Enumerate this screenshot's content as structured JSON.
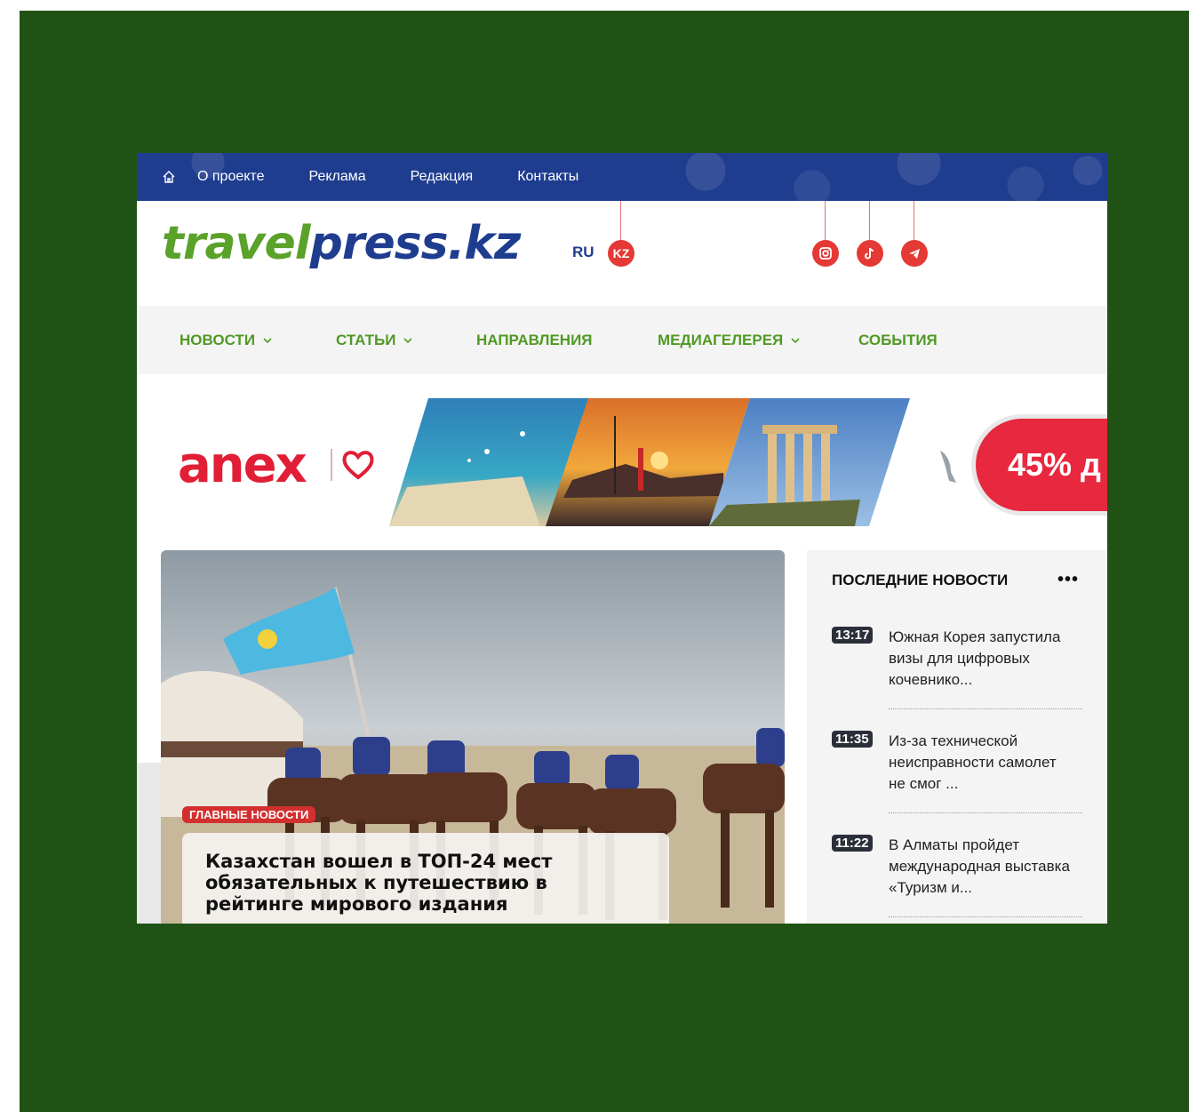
{
  "topbar": {
    "items": [
      "О проекте",
      "Реклама",
      "Редакция",
      "Контакты"
    ]
  },
  "header": {
    "logo_part1": "travel",
    "logo_part2": "press.kz",
    "lang_ru": "RU",
    "lang_kz": "KZ"
  },
  "nav": {
    "items": [
      {
        "label": "НОВОСТИ",
        "has_dropdown": true
      },
      {
        "label": "СТАТЬИ",
        "has_dropdown": true
      },
      {
        "label": "НАПРАВЛЕНИЯ",
        "has_dropdown": false
      },
      {
        "label": "МЕДИАГЕЛЕРЕЯ",
        "has_dropdown": true
      },
      {
        "label": "СОБЫТИЯ",
        "has_dropdown": false
      }
    ]
  },
  "banner": {
    "brand": "anex",
    "promo": "45% д"
  },
  "feature": {
    "badge": "ГЛАВНЫЕ НОВОСТИ",
    "headline": "Казахстан вошел в ТОП-24 мест обязательных к путешествию в рейтинге мирового издания"
  },
  "sidebar": {
    "title": "ПОСЛЕДНИЕ НОВОСТИ",
    "more": "•••",
    "items": [
      {
        "time": "13:17",
        "text": "Южная Корея запустила визы для цифровых кочевнико..."
      },
      {
        "time": "11:35",
        "text": "Из-за технической неисправности самолет не смог ..."
      },
      {
        "time": "11:22",
        "text": "В Алматы пройдет международная выставка «Туризм и..."
      }
    ]
  },
  "colors": {
    "outer_background": "#215215",
    "topbar": "#1f3d8f",
    "nav_text": "#4f9a24",
    "accent_red": "#e53935"
  }
}
